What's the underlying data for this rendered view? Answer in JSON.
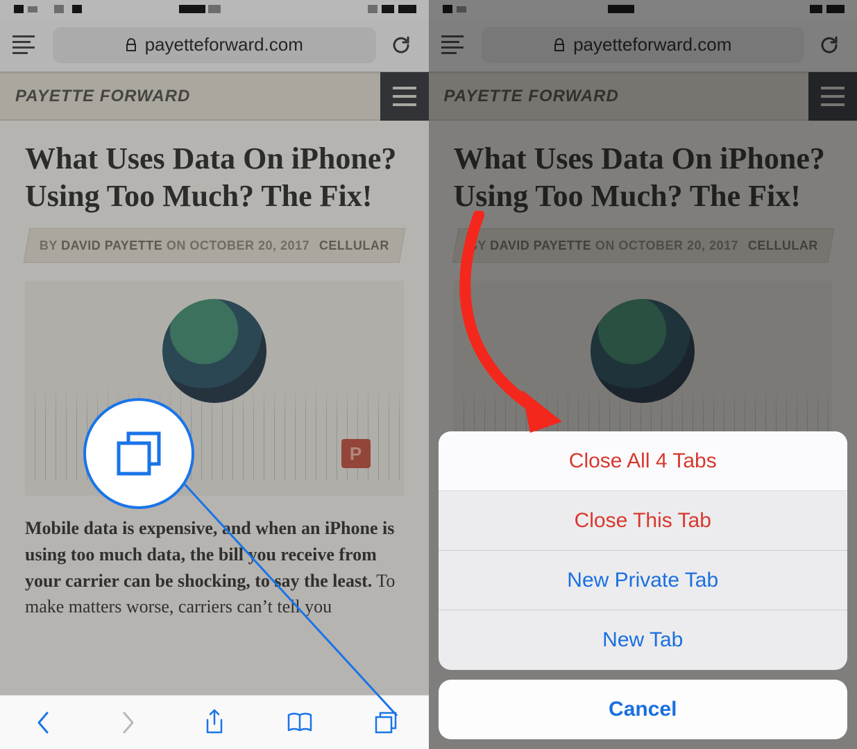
{
  "browser": {
    "url_host": "payetteforward.com"
  },
  "site": {
    "brand": "PAYETTE FORWARD"
  },
  "article": {
    "headline": "What Uses Data On iPhone? Using Too Much? The Fix!",
    "by_label": "BY",
    "author": "DAVID PAYETTE",
    "on_label": "ON",
    "date": "OCTOBER 20, 2017",
    "category": "CELLULAR",
    "chip_letter": "P",
    "body_bold": "Mobile data is expensive, and when an iPhone is using too much data, the bill you receive from your carrier can be shocking, to say the least.",
    "body_rest": " To make matters worse, carriers can’t tell you"
  },
  "action_sheet": {
    "close_all": "Close All 4 Tabs",
    "close_this": "Close This Tab",
    "new_private": "New Private Tab",
    "new_tab": "New Tab",
    "cancel": "Cancel"
  }
}
